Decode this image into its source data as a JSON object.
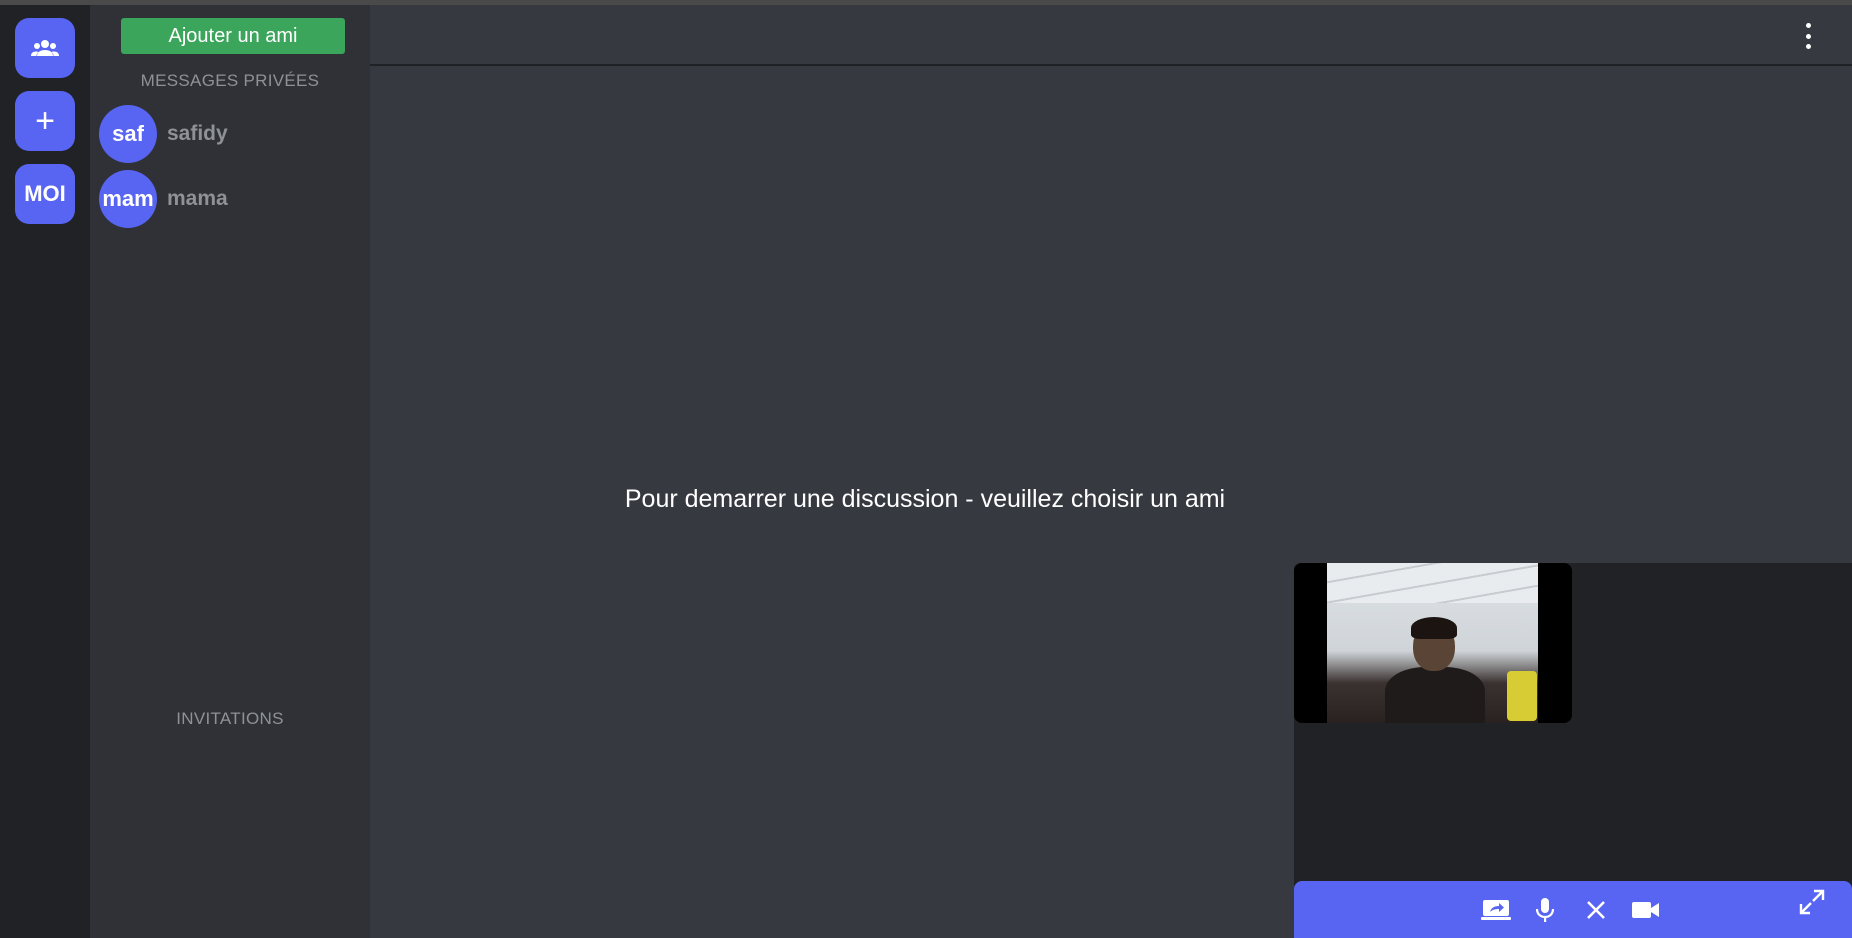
{
  "rail": {
    "friends_icon": "people-group-icon",
    "add_label": "+",
    "me_label": "MOI",
    "accent": "#5865f2"
  },
  "dm_panel": {
    "add_friend_label": "Ajouter un ami",
    "section_private": "MESSAGES PRIVÉES",
    "section_invitations": "INVITATIONS",
    "items": [
      {
        "avatar_text": "saf",
        "name": "safidy"
      },
      {
        "avatar_text": "mam",
        "name": "mama"
      }
    ]
  },
  "main": {
    "empty_message": "Pour demarrer une discussion - veuillez choisir un ami",
    "menu_icon": "kebab-menu-icon"
  },
  "call": {
    "controls": [
      "screen-share-icon",
      "microphone-icon",
      "hang-up-icon",
      "camera-icon",
      "fullscreen-icon"
    ],
    "bar_color": "#5865f2"
  }
}
